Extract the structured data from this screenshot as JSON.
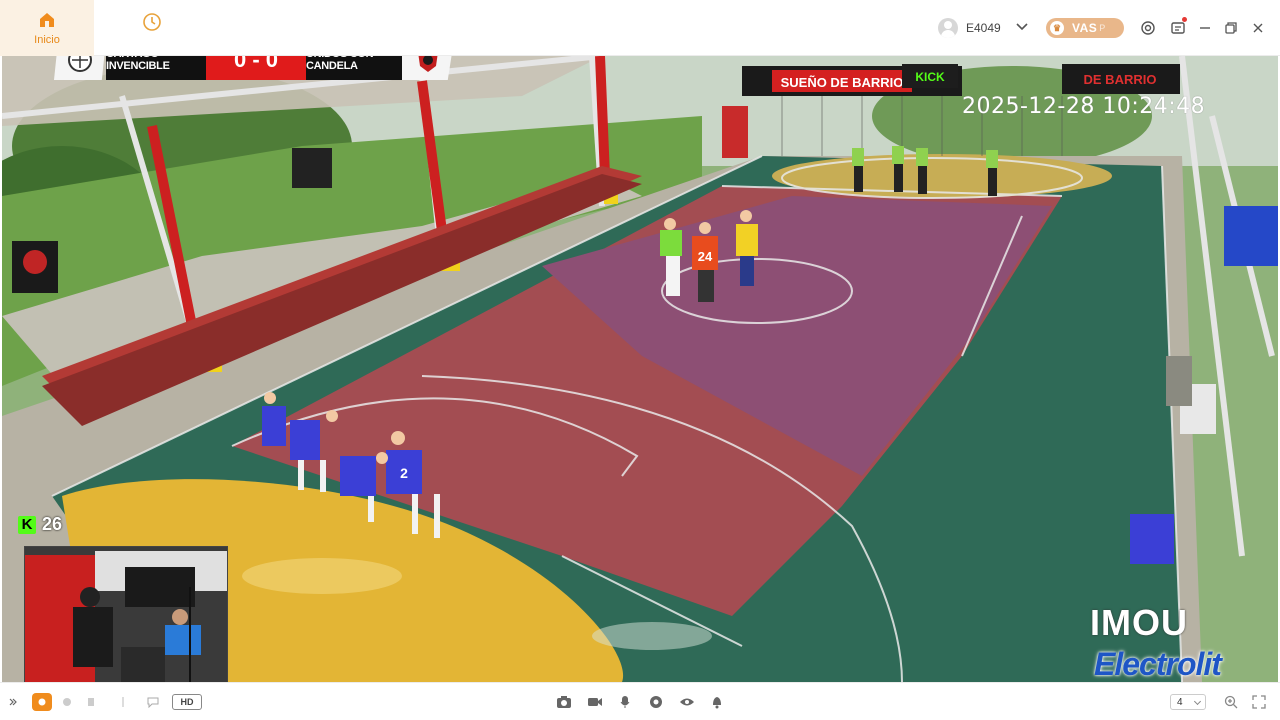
{
  "titlebar": {
    "home_label": "Inicio",
    "username": "E4049",
    "vas_label": "VAS",
    "vas_sub": "P"
  },
  "icons": {
    "home": "home-icon",
    "history": "clock-icon",
    "user": "avatar-icon",
    "dropdown": "chevron-down-icon",
    "settings": "target-settings-icon",
    "messages": "message-icon",
    "minimize": "minimize-icon",
    "maximize": "restore-icon",
    "close": "close-icon"
  },
  "video": {
    "scoreboard": {
      "home_team": "CARTAGO INVENCIBLE",
      "score": "0 - 0",
      "away_team": "UNIDOS CON CANDELA"
    },
    "timestamp": "2025-12-28 10:24:48",
    "kick_count": "26",
    "watermark": "IMOU",
    "sponsor": "Electrolit",
    "banners": {
      "top_center": "SUEÑO DE BARRIO",
      "top_right": "DE BARRIO",
      "kick": "KICK"
    },
    "jerseys": {
      "referee_center": "24",
      "blue_front": "2"
    }
  },
  "bottombar": {
    "quality": "HD",
    "layout_value": "4"
  },
  "colors": {
    "accent": "#f08c1d",
    "scoreboard_red": "#e01b1b",
    "court_red": "#a64a4a",
    "court_green": "#2f6a57",
    "court_yellow": "#e2b436"
  }
}
